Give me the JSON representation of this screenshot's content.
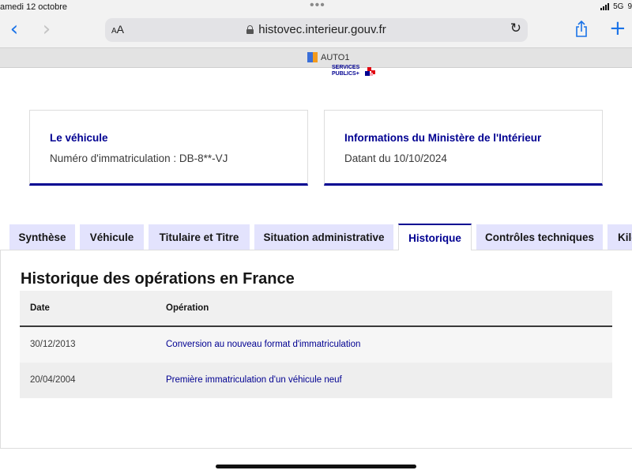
{
  "status_bar": {
    "time": "amedi 12 octobre",
    "network": "5G",
    "battery_fragment": "9"
  },
  "browser": {
    "reader_label_small": "A",
    "reader_label_big": "A",
    "url": "histovec.interieur.gouv.fr",
    "tab_title": "AUTO1",
    "icons": [
      "back-chevron-icon",
      "forward-chevron-icon",
      "lock-icon",
      "reload-icon",
      "share-icon",
      "plus-icon"
    ]
  },
  "logo": {
    "line1": "SERVICES",
    "line2": "PUBLICS+"
  },
  "cards": [
    {
      "title": "Le véhicule",
      "text": "Numéro d'immatriculation : DB-8**-VJ"
    },
    {
      "title": "Informations du Ministère de l'Intérieur",
      "text": "Datant du 10/10/2024"
    }
  ],
  "tabs": [
    {
      "label": "Synthèse",
      "active": false
    },
    {
      "label": "Véhicule",
      "active": false
    },
    {
      "label": "Titulaire et Titre",
      "active": false
    },
    {
      "label": "Situation administrative",
      "active": false
    },
    {
      "label": "Historique",
      "active": true
    },
    {
      "label": "Contrôles techniques",
      "active": false
    },
    {
      "label": "Kilo",
      "active": false
    }
  ],
  "history": {
    "title": "Historique des opérations en France",
    "columns": [
      "Date",
      "Opération"
    ],
    "rows": [
      {
        "date": "30/12/2013",
        "operation": "Conversion au nouveau format d'immatriculation"
      },
      {
        "date": "20/04/2004",
        "operation": "Première immatriculation d'un véhicule neuf"
      }
    ]
  },
  "colors": {
    "accent": "#000091",
    "tab_inactive_bg": "#e3e3fd",
    "safari_blue": "#1a73e8",
    "logo_red": "#e1000f"
  }
}
